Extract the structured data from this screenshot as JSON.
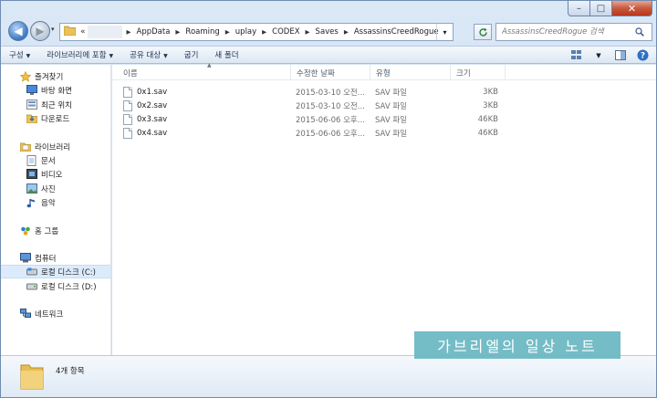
{
  "window": {
    "controls": {
      "minimize": "–",
      "maximize": "□",
      "close": "✕"
    }
  },
  "nav": {
    "back": "◀",
    "forward": "▶",
    "history": "▾",
    "address": {
      "hidden_marker": "«",
      "crumbs": [
        "AppData",
        "Roaming",
        "uplay",
        "CODEX",
        "Saves",
        "AssassinsCreedRogue"
      ]
    },
    "search_placeholder": "AssassinsCreedRogue 검색"
  },
  "toolbar": {
    "items": [
      {
        "label": "구성",
        "dropdown": true
      },
      {
        "label": "라이브러리에 포함",
        "dropdown": true
      },
      {
        "label": "공유 대상",
        "dropdown": true
      },
      {
        "label": "굽기",
        "dropdown": false
      },
      {
        "label": "새 폴더",
        "dropdown": false
      }
    ]
  },
  "sidebar": {
    "items": [
      {
        "label": "즐겨찾기",
        "icon": "star-icon",
        "level": 0
      },
      {
        "label": "바탕 화면",
        "icon": "desktop-icon",
        "level": 1
      },
      {
        "label": "최근 위치",
        "icon": "recent-places-icon",
        "level": 1
      },
      {
        "label": "다운로드",
        "icon": "downloads-icon",
        "level": 1
      },
      {
        "label": "라이브러리",
        "icon": "library-icon",
        "level": 0
      },
      {
        "label": "문서",
        "icon": "documents-icon",
        "level": 1
      },
      {
        "label": "비디오",
        "icon": "video-icon",
        "level": 1
      },
      {
        "label": "사진",
        "icon": "pictures-icon",
        "level": 1
      },
      {
        "label": "음악",
        "icon": "music-icon",
        "level": 1
      },
      {
        "label": "홈 그룹",
        "icon": "homegroup-icon",
        "level": 0
      },
      {
        "label": "컴퓨터",
        "icon": "computer-icon",
        "level": 0
      },
      {
        "label": "로컬 디스크 (C:)",
        "icon": "drive-c-icon",
        "level": 1,
        "selected": true
      },
      {
        "label": "로컬 디스크 (D:)",
        "icon": "drive-d-icon",
        "level": 1
      },
      {
        "label": "네트워크",
        "icon": "network-icon",
        "level": 0
      }
    ]
  },
  "columns": {
    "name": "이름",
    "date": "수정한 날짜",
    "type": "유형",
    "size": "크기"
  },
  "files": [
    {
      "name": "0x1.sav",
      "date": "2015-03-10 오전...",
      "type": "SAV 파일",
      "size": "3KB"
    },
    {
      "name": "0x2.sav",
      "date": "2015-03-10 오전...",
      "type": "SAV 파일",
      "size": "3KB"
    },
    {
      "name": "0x3.sav",
      "date": "2015-06-06 오후...",
      "type": "SAV 파일",
      "size": "46KB"
    },
    {
      "name": "0x4.sav",
      "date": "2015-06-06 오후...",
      "type": "SAV 파일",
      "size": "46KB"
    }
  ],
  "details": {
    "item_count": "4개 항목"
  },
  "watermark": "가브리엘의 일상 노트",
  "colors": {
    "selection": "#dcebfb",
    "watermark_bg": "#69b7c2",
    "close_button": "#c75a3f"
  }
}
